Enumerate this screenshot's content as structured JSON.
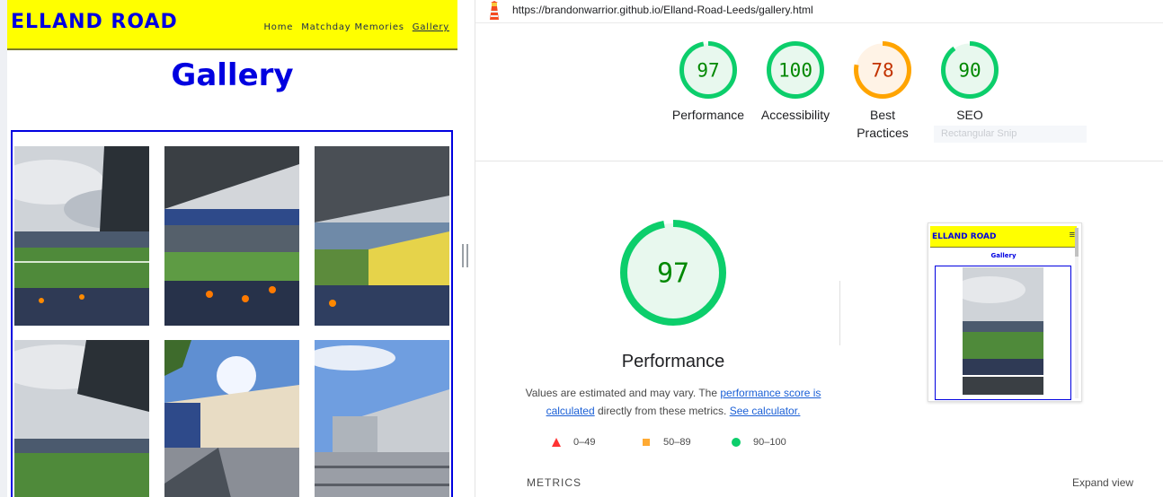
{
  "site": {
    "logo": "ELLAND ROAD",
    "nav": [
      "Home",
      "Matchday Memories",
      "Gallery"
    ],
    "active_nav": "Gallery",
    "page_title": "Gallery",
    "brand_color": "#0000e0",
    "header_color": "#ffff00"
  },
  "report": {
    "url": "https://brandonwarrior.github.io/Elland-Road-Leeds/gallery.html",
    "categories": [
      {
        "label": "Performance",
        "score": 97,
        "rating": "pass"
      },
      {
        "label": "Accessibility",
        "score": 100,
        "rating": "pass"
      },
      {
        "label": "Best Practices",
        "score": 78,
        "rating": "average"
      },
      {
        "label": "SEO",
        "score": 90,
        "rating": "pass"
      }
    ],
    "ghost_tooltip": "Rectangular Snip",
    "main": {
      "score": 97,
      "label": "Performance",
      "note_prefix": "Values are estimated and may vary. The ",
      "note_link1": "performance score is calculated",
      "note_middle": " directly from these metrics. ",
      "note_link2": "See calculator."
    },
    "legend": [
      {
        "range": "0–49",
        "icon": "triangle-icon",
        "color": "#ff3333"
      },
      {
        "range": "50–89",
        "icon": "square-icon",
        "color": "#ffaa33"
      },
      {
        "range": "90–100",
        "icon": "circle-icon",
        "color": "#0cce6b"
      }
    ],
    "thumbnail": {
      "logo": "ELLAND ROAD",
      "title": "Gallery",
      "menu_icon": "hamburger-icon"
    },
    "metrics_label": "METRICS",
    "expand_label": "Expand view",
    "colors": {
      "pass": "#0cce6b",
      "pass_text": "#008800",
      "pass_fill": "#e8f8ee",
      "average": "#ffa400",
      "average_text": "#c33300",
      "average_fill": "#fff3e6",
      "link": "#1a5fd6"
    }
  }
}
